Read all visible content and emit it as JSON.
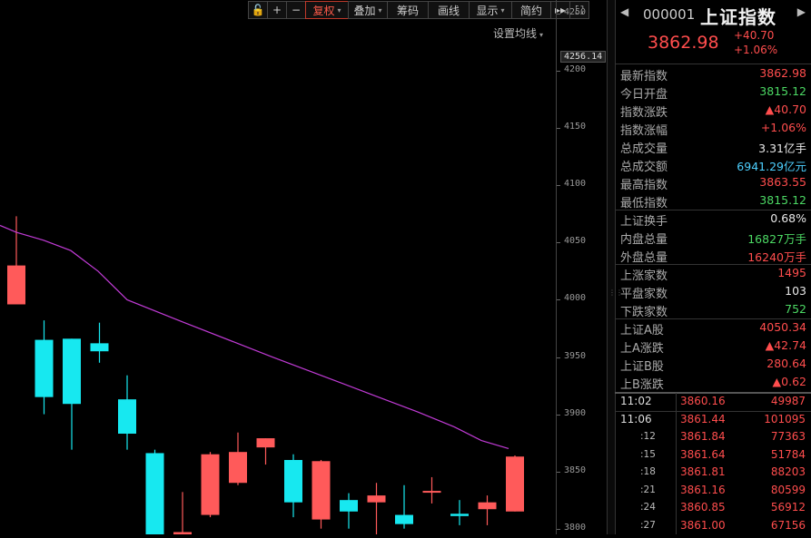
{
  "toolbar": {
    "items": [
      {
        "key": "lock",
        "label": "🔓",
        "icon": "unlock-icon"
      },
      {
        "key": "zoom_in",
        "label": "+",
        "icon": "plus-icon"
      },
      {
        "key": "zoom_out",
        "label": "−",
        "icon": "minus-icon"
      },
      {
        "key": "fuquan",
        "label": "复权",
        "dropdown": true,
        "active": true
      },
      {
        "key": "diejia",
        "label": "叠加",
        "dropdown": true
      },
      {
        "key": "choumao",
        "label": "筹码"
      },
      {
        "key": "huaxian",
        "label": "画线"
      },
      {
        "key": "xianshi",
        "label": "显示",
        "dropdown": true
      },
      {
        "key": "jianyue",
        "label": "简约"
      },
      {
        "key": "forward",
        "label": "▸▸",
        "icon": "fast-forward-icon"
      },
      {
        "key": "fullscreen",
        "label": "⛶",
        "icon": "fullscreen-icon"
      }
    ],
    "ma_setting": "设置均线"
  },
  "chart_data": {
    "type": "candlestick",
    "ylim": [
      3795,
      4262
    ],
    "y_ticks": [
      3800,
      3850,
      3900,
      3950,
      4000,
      4050,
      4100,
      4150,
      4200,
      4250
    ],
    "y_max_label": "4256.14",
    "candles": [
      {
        "open": 3996,
        "close": 4030,
        "high": 4073,
        "low": 3996
      },
      {
        "open": 3965,
        "close": 3915,
        "high": 3982,
        "low": 3900
      },
      {
        "open": 3966,
        "close": 3909,
        "high": 3966,
        "low": 3869
      },
      {
        "open": 3962,
        "close": 3955,
        "high": 3980,
        "low": 3945
      },
      {
        "open": 3913,
        "close": 3883,
        "high": 3934,
        "low": 3869
      },
      {
        "open": 3866,
        "close": 3790,
        "high": 3869,
        "low": 3780
      },
      {
        "open": 3793,
        "close": 3797,
        "high": 3832,
        "low": 3790
      },
      {
        "open": 3812,
        "close": 3865,
        "high": 3867,
        "low": 3810
      },
      {
        "open": 3840,
        "close": 3867,
        "high": 3884,
        "low": 3838
      },
      {
        "open": 3871,
        "close": 3879,
        "high": 3879,
        "low": 3856
      },
      {
        "open": 3860,
        "close": 3823,
        "high": 3865,
        "low": 3810
      },
      {
        "open": 3808,
        "close": 3859,
        "high": 3860,
        "low": 3800
      },
      {
        "open": 3825,
        "close": 3815,
        "high": 3831,
        "low": 3800
      },
      {
        "open": 3823,
        "close": 3829,
        "high": 3840,
        "low": 3785
      },
      {
        "open": 3812,
        "close": 3804,
        "high": 3838,
        "low": 3800
      },
      {
        "open": 3832,
        "close": 3833,
        "high": 3845,
        "low": 3822
      },
      {
        "open": 3813,
        "close": 3811,
        "high": 3825,
        "low": 3803
      },
      {
        "open": 3817,
        "close": 3823,
        "high": 3829,
        "low": 3803
      },
      {
        "open": 3815,
        "close": 3863,
        "high": 3864,
        "low": 3815
      }
    ],
    "ma": [
      4065,
      4059,
      4052,
      4043,
      4025,
      4000,
      3981,
      3963,
      3950,
      3935,
      3917,
      3902,
      3889,
      3877,
      3870
    ]
  },
  "panel": {
    "code": "000001",
    "name": "上证指数",
    "price": "3862.98",
    "change": "+40.70",
    "change_pct": "+1.06%",
    "stats": [
      {
        "label": "最新指数",
        "value": "3862.98",
        "color": "#ff4d4d"
      },
      {
        "label": "今日开盘",
        "value": "3815.12",
        "color": "#4cd964"
      },
      {
        "label": "指数涨跌",
        "value": "▲40.70",
        "color": "#ff4d4d"
      },
      {
        "label": "指数涨幅",
        "value": "+1.06%",
        "color": "#ff4d4d"
      },
      {
        "label": "总成交量",
        "value": "3.31亿手",
        "color": "#e8e8e8"
      },
      {
        "label": "总成交额",
        "value": "6941.29亿元",
        "color": "#4dd0ff"
      },
      {
        "label": "最高指数",
        "value": "3863.55",
        "color": "#ff4d4d"
      },
      {
        "label": "最低指数",
        "value": "3815.12",
        "color": "#4cd964"
      },
      {
        "label": "上证换手",
        "value": "0.68%",
        "color": "#e8e8e8"
      },
      {
        "label": "内盘总量",
        "value": "16827万手",
        "color": "#4cd964"
      },
      {
        "label": "外盘总量",
        "value": "16240万手",
        "color": "#ff4d4d"
      },
      {
        "label": "上涨家数",
        "value": "1495",
        "color": "#ff4d4d"
      },
      {
        "label": "平盘家数",
        "value": "103",
        "color": "#e8e8e8"
      },
      {
        "label": "下跌家数",
        "value": "752",
        "color": "#4cd964"
      },
      {
        "label": "上证A股",
        "value": "4050.34",
        "color": "#ff4d4d"
      },
      {
        "label": "上A涨跌",
        "value": "▲42.74",
        "color": "#ff4d4d"
      },
      {
        "label": "上证B股",
        "value": "280.64",
        "color": "#ff4d4d"
      },
      {
        "label": "上B涨跌",
        "value": "▲0.62",
        "color": "#ff4d4d"
      }
    ],
    "ticks": [
      {
        "time": "11:02",
        "price": "3860.16",
        "vol": "49987",
        "small": false
      },
      {
        "time": "11:06",
        "price": "3861.44",
        "vol": "101095",
        "small": false
      },
      {
        "time": ":12",
        "price": "3861.84",
        "vol": "77363",
        "small": true
      },
      {
        "time": ":15",
        "price": "3861.64",
        "vol": "51784",
        "small": true
      },
      {
        "time": ":18",
        "price": "3861.81",
        "vol": "88203",
        "small": true
      },
      {
        "time": ":21",
        "price": "3861.16",
        "vol": "80599",
        "small": true
      },
      {
        "time": ":24",
        "price": "3860.85",
        "vol": "56912",
        "small": true
      },
      {
        "time": ":27",
        "price": "3861.00",
        "vol": "67156",
        "small": true
      }
    ]
  }
}
